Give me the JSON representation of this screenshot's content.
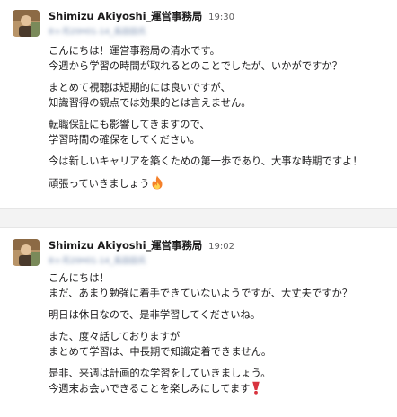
{
  "messages": [
    {
      "sender": "Shimizu Akiyoshi_運営事務局",
      "time": "19:30",
      "subtitle": "8ヶ月20H01-14_長田田氏",
      "paragraphs": [
        [
          "こんにちは！運営事務局の清水です。",
          "今週から学習の時間が取れるとのことでしたが、いかがですか？"
        ],
        [
          "まとめて視聴は短期的には良いですが、",
          "知識習得の観点では効果的とは言えません。"
        ],
        [
          "転職保証にも影響してきますので、",
          "学習時間の確保をしてください。"
        ],
        [
          "今は新しいキャリアを築くための第一歩であり、大事な時期ですよ！"
        ],
        [
          "頑張っていきましょう"
        ]
      ],
      "end_emoji": "fire-icon"
    },
    {
      "sender": "Shimizu Akiyoshi_運営事務局",
      "time": "19:02",
      "subtitle": "8ヶ月20H01-14_長田田氏",
      "paragraphs": [
        [
          "こんにちは！",
          "まだ、あまり勉強に着手できていないようですが、大丈夫ですか？"
        ],
        [
          "明日は休日なので、是非学習してくださいね。"
        ],
        [
          "また、度々話しておりますが",
          "まとめて学習は、中長期で知識定着できません。"
        ],
        [
          "是非、来週は計画的な学習をしていきましょう。",
          "今週末お会いできることを楽しみにしてます"
        ]
      ],
      "end_emoji": "exclamation-icon"
    }
  ],
  "colors": {
    "text": "#1d1c1d",
    "timestamp": "#616061",
    "separator": "#f3f3f3",
    "fire": "#f4802a",
    "exclamation": "#d8343f"
  }
}
